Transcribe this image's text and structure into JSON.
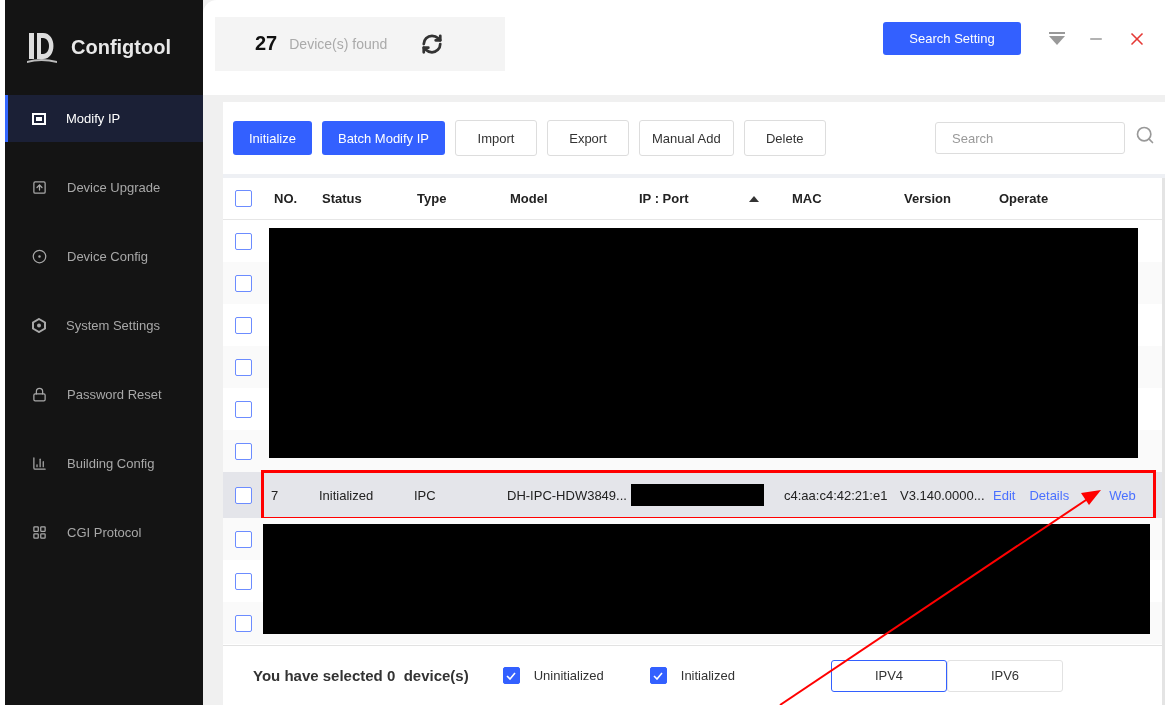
{
  "app": {
    "name": "Configtool"
  },
  "sidebar": {
    "items": [
      {
        "label": "Modify IP",
        "selected": true
      },
      {
        "label": "Device Upgrade",
        "selected": false
      },
      {
        "label": "Device Config",
        "selected": false
      },
      {
        "label": "System Settings",
        "selected": false
      },
      {
        "label": "Password Reset",
        "selected": false
      },
      {
        "label": "Building Config",
        "selected": false
      },
      {
        "label": "CGI Protocol",
        "selected": false
      }
    ]
  },
  "header": {
    "count": "27",
    "count_label": "Device(s) found",
    "search_setting": "Search Setting"
  },
  "toolbar": {
    "buttons": [
      {
        "label": "Initialize",
        "kind": "primary"
      },
      {
        "label": "Batch Modify IP",
        "kind": "primary"
      },
      {
        "label": "Import",
        "kind": "plain"
      },
      {
        "label": "Export",
        "kind": "plain"
      },
      {
        "label": "Manual Add",
        "kind": "plain"
      },
      {
        "label": "Delete",
        "kind": "plain"
      }
    ],
    "search": {
      "placeholder": "Search"
    }
  },
  "table": {
    "header_checked": false,
    "columns": [
      {
        "label": "NO.",
        "sorted": false
      },
      {
        "label": "Status",
        "sorted": false
      },
      {
        "label": "Type",
        "sorted": false
      },
      {
        "label": "Model",
        "sorted": false
      },
      {
        "label": "IP : Port",
        "sorted": true
      },
      {
        "label": "MAC",
        "sorted": false
      },
      {
        "label": "Version",
        "sorted": false
      },
      {
        "label": "Operate",
        "sorted": false
      }
    ],
    "rows": [
      {
        "kind": "redacted",
        "checked": false
      },
      {
        "kind": "redacted",
        "checked": false
      },
      {
        "kind": "redacted",
        "checked": false
      },
      {
        "kind": "redacted",
        "checked": false
      },
      {
        "kind": "redacted",
        "checked": false
      },
      {
        "kind": "redacted",
        "checked": false
      },
      {
        "kind": "device",
        "checked": false,
        "highlighted": true,
        "no": "7",
        "status": "Initialized",
        "type": "IPC",
        "model": "DH-IPC-HDW3849...",
        "mac": "c4:aa:c4:42:21:e1",
        "version": "V3.140.0000...",
        "actions": [
          "Edit",
          "Details",
          "Web"
        ]
      },
      {
        "kind": "redacted",
        "checked": false
      },
      {
        "kind": "redacted",
        "checked": false
      },
      {
        "kind": "redacted",
        "checked": false
      }
    ]
  },
  "footer": {
    "selected_text": "You have selected **0**  device(s)",
    "filters": [
      {
        "label": "Uninitialized",
        "checked": true
      },
      {
        "label": "Initialized",
        "checked": true
      }
    ],
    "ip_tabs": [
      {
        "label": "IPV4",
        "selected": true
      },
      {
        "label": "IPV6",
        "selected": false
      }
    ]
  },
  "annotation": {
    "arrow": true
  }
}
